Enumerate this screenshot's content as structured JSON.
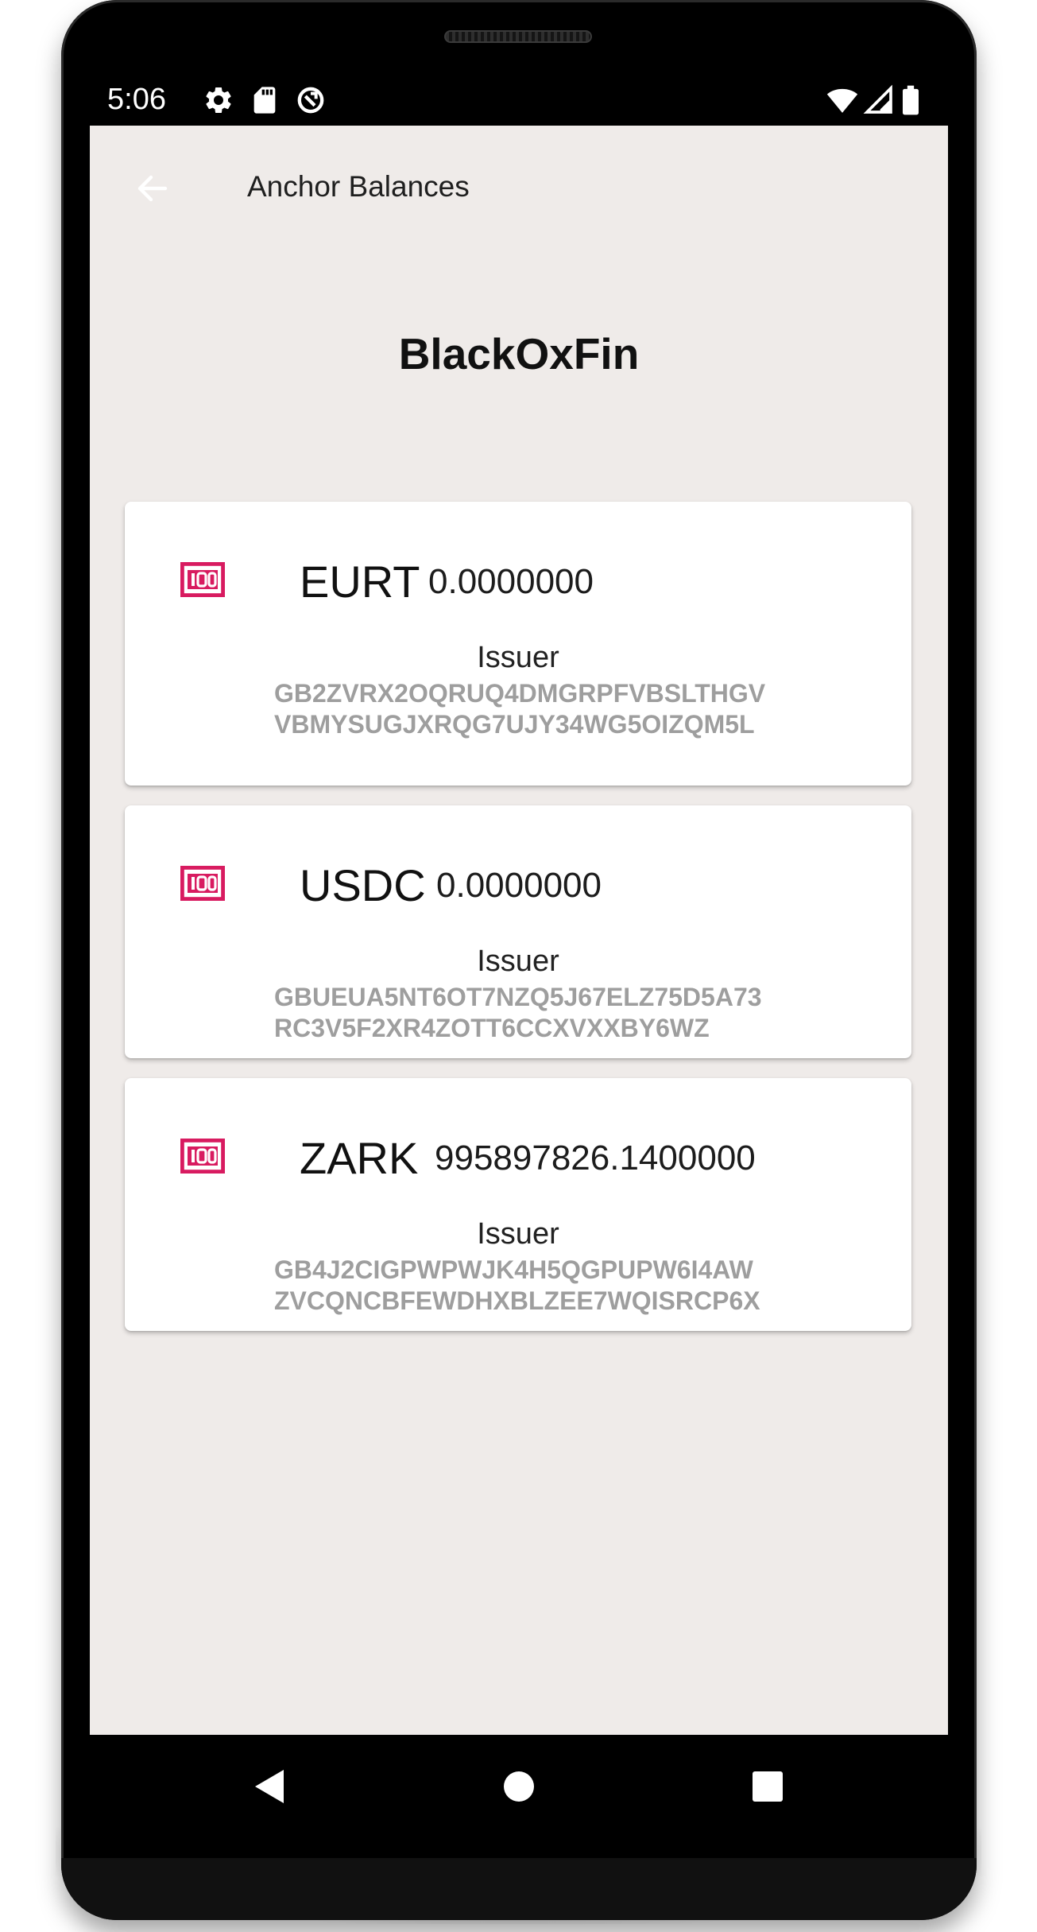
{
  "status_bar": {
    "time": "5:06",
    "left_icons": [
      "gear-icon",
      "sd-card-icon",
      "sync-disabled-icon"
    ],
    "right_icons": [
      "wifi-icon",
      "cell-signal-icon",
      "battery-icon"
    ]
  },
  "app_bar": {
    "back_icon": "arrow-back-icon",
    "title": "Anchor Balances"
  },
  "anchor": {
    "name": "BlackOxFin"
  },
  "balances": [
    {
      "icon": "money-icon",
      "code": "EURT",
      "balance": "0.0000000",
      "issuer_label": "Issuer",
      "issuer": "GB2ZVRX2OQRUQ4DMGRPFVBSLTHGVVBMYSUGJXRQG7UJY34WG5OIZQM5L"
    },
    {
      "icon": "money-icon",
      "code": "USDC",
      "balance": "0.0000000",
      "issuer_label": "Issuer",
      "issuer": "GBUEUA5NT6OT7NZQ5J67ELZ75D5A73RC3V5F2XR4ZOTT6CCXVXXBY6WZ"
    },
    {
      "icon": "money-icon",
      "code": "ZARK",
      "balance": "995897826.1400000",
      "issuer_label": "Issuer",
      "issuer": "GB4J2CIGPWPWJK4H5QGPUPW6I4AWZVCQNCBFEWDHXBLZEE7WQISRCP6X"
    }
  ],
  "nav_bar": {
    "icons": [
      "back-triangle-icon",
      "home-circle-icon",
      "recents-square-icon"
    ]
  },
  "colors": {
    "screen_background": "#efebe9",
    "accent": "#d81b60",
    "issuer_text": "#9e9e9e",
    "card_background": "#ffffff"
  }
}
